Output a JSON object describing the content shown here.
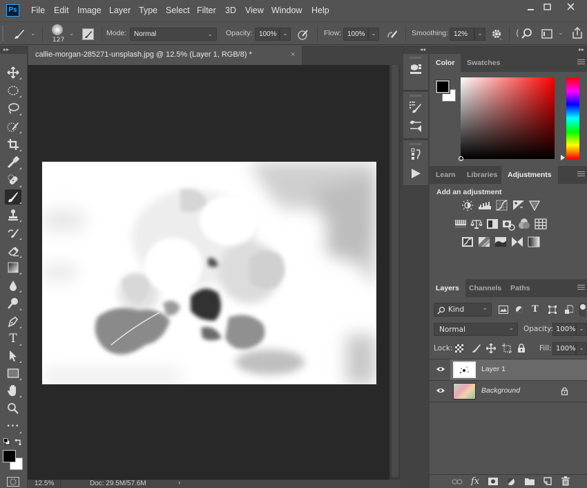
{
  "app": {
    "logo": "Ps",
    "menu": [
      "File",
      "Edit",
      "Image",
      "Layer",
      "Type",
      "Select",
      "Filter",
      "3D",
      "View",
      "Window",
      "Help"
    ],
    "window_controls": {
      "minimize": "minimize-icon",
      "maximize": "maximize-icon",
      "close": "close-icon"
    }
  },
  "options": {
    "brush_size": "127",
    "mode_label": "Mode:",
    "mode_value": "Normal",
    "opacity_label": "Opacity:",
    "opacity_value": "100%",
    "flow_label": "Flow:",
    "flow_value": "100%",
    "smoothing_label": "Smoothing:",
    "smoothing_value": "12%",
    "partial_glyph": "("
  },
  "document": {
    "tab_title": "callie-morgan-285271-unsplash.jpg @ 12.5% (Layer 1, RGB/8) *",
    "close_glyph": "×",
    "zoom_level": "12.5%",
    "doc_info": "Doc: 29.5M/57.6M",
    "status_arrow": "›"
  },
  "toolbar": {
    "tools": [
      {
        "name": "move-tool",
        "icon": "move-icon"
      },
      {
        "name": "elliptical-marquee-tool",
        "icon": "ellipse-marquee-icon"
      },
      {
        "name": "lasso-tool",
        "icon": "lasso-icon"
      },
      {
        "name": "quick-selection-tool",
        "icon": "quick-selection-icon"
      },
      {
        "name": "crop-tool",
        "icon": "crop-icon"
      },
      {
        "name": "eyedropper-tool",
        "icon": "eyedropper-icon"
      },
      {
        "name": "healing-brush-tool",
        "icon": "bandage-icon"
      },
      {
        "name": "brush-tool",
        "icon": "brush-icon",
        "active": true
      },
      {
        "name": "clone-stamp-tool",
        "icon": "stamp-icon"
      },
      {
        "name": "history-brush-tool",
        "icon": "history-brush-icon"
      },
      {
        "name": "eraser-tool",
        "icon": "eraser-icon"
      },
      {
        "name": "gradient-tool",
        "icon": "gradient-icon"
      },
      {
        "name": "blur-tool",
        "icon": "drop-icon"
      },
      {
        "name": "dodge-tool",
        "icon": "dodge-icon"
      },
      {
        "name": "pen-tool",
        "icon": "pen-icon"
      },
      {
        "name": "type-tool",
        "icon": "type-icon"
      },
      {
        "name": "path-selection-tool",
        "icon": "arrow-icon"
      },
      {
        "name": "rectangle-tool",
        "icon": "rectangle-icon"
      },
      {
        "name": "hand-tool",
        "icon": "hand-icon"
      },
      {
        "name": "zoom-tool",
        "icon": "magnifier-icon"
      },
      {
        "name": "edit-toolbar",
        "icon": "more-icon"
      }
    ],
    "type_glyph": "T",
    "more_glyph": "•••",
    "foreground_color": "#000000",
    "background_color": "#ffffff"
  },
  "color_panel": {
    "tabs": [
      "Color",
      "Swatches"
    ],
    "active_tab": "Color",
    "foreground": "#000000",
    "background": "#ffffff",
    "hue_color": "#ff0000"
  },
  "adjustments_panel": {
    "tabs": [
      "Learn",
      "Libraries",
      "Adjustments"
    ],
    "active_tab": "Adjustments",
    "heading": "Add an adjustment",
    "rows": [
      [
        "brightness-contrast-icon",
        "levels-icon",
        "curves-icon",
        "exposure-icon",
        "gradient-triangle-icon"
      ],
      [
        "vibrance-icon",
        "color-balance-icon",
        "black-white-icon",
        "photo-filter-icon",
        "channel-mixer-icon",
        "color-lookup-icon"
      ],
      [
        "invert-icon",
        "posterize-icon",
        "threshold-icon",
        "selective-color-icon",
        "gradient-map-icon"
      ]
    ]
  },
  "layers_panel": {
    "tabs": [
      "Layers",
      "Channels",
      "Paths"
    ],
    "active_tab": "Layers",
    "filter_kind": "Kind",
    "blend_mode": "Normal",
    "opacity_label": "Opacity:",
    "opacity_value": "100%",
    "lock_label": "Lock:",
    "fill_label": "Fill:",
    "fill_value": "100%",
    "layers": [
      {
        "name": "Layer 1",
        "visible": true,
        "selected": true,
        "locked": false
      },
      {
        "name": "Background",
        "visible": true,
        "selected": false,
        "locked": true
      }
    ],
    "footer_icons": [
      "link-icon",
      "fx-icon",
      "mask-icon",
      "adjustment-layer-icon",
      "group-folder-icon",
      "new-layer-icon",
      "trash-icon"
    ],
    "fx_glyph": "fx"
  }
}
